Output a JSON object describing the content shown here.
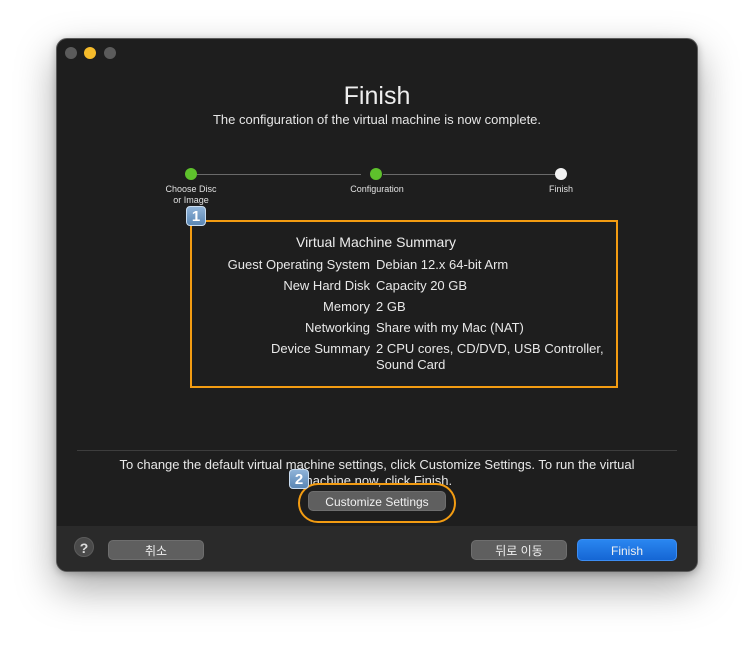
{
  "window": {
    "title": "Finish",
    "subtitle": "The configuration of the virtual machine is now complete."
  },
  "steps": [
    {
      "label": "Choose Disc\nor Image",
      "state": "done"
    },
    {
      "label": "Configuration",
      "state": "done"
    },
    {
      "label": "Finish",
      "state": "current"
    }
  ],
  "badges": [
    "1",
    "2"
  ],
  "summary": {
    "heading": "Virtual Machine Summary",
    "rows": [
      {
        "label": "Guest Operating System",
        "value": "Debian 12.x 64-bit Arm"
      },
      {
        "label": "New Hard Disk",
        "value": "Capacity 20 GB"
      },
      {
        "label": "Memory",
        "value": "2 GB"
      },
      {
        "label": "Networking",
        "value": "Share with my Mac (NAT)"
      },
      {
        "label": "Device Summary",
        "value": "2 CPU cores, CD/DVD, USB Controller, Sound Card"
      }
    ]
  },
  "hint": "To change the default virtual machine settings, click Customize Settings. To run the virtual machine now, click Finish.",
  "buttons": {
    "customize": "Customize Settings",
    "help": "?",
    "cancel": "취소",
    "back": "뒤로 이동",
    "finish": "Finish"
  },
  "colors": {
    "step_done": "#5ec12c",
    "step_current": "#f2f2f2",
    "highlight": "#f39c12",
    "primary": "#1a73e8",
    "window_bg": "#1e1e1e"
  }
}
